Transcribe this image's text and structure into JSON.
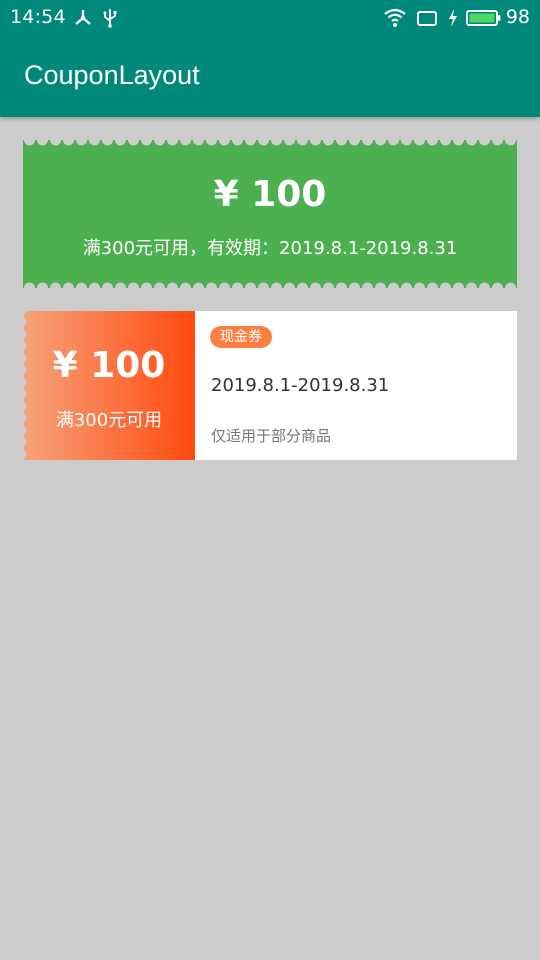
{
  "status_bar": {
    "time": "14:54",
    "battery_percent": "98",
    "icons": [
      "network-share-icon",
      "usb-icon",
      "wifi-icon",
      "screen-icon",
      "charging-icon",
      "battery-icon"
    ]
  },
  "app_bar": {
    "title": "CouponLayout"
  },
  "coupon_green": {
    "amount": "¥ 100",
    "description": "满300元可用，有效期：2019.8.1-2019.8.31",
    "color": "#4caf50"
  },
  "coupon_orange": {
    "amount": "¥ 100",
    "min_spend": "满300元可用",
    "badge": "现金券",
    "date_range": "2019.8.1-2019.8.31",
    "scope": "仅适用于部分商品",
    "gradient_start": "#f6a27b",
    "gradient_end": "#ff4a0f"
  },
  "colors": {
    "primary": "#00897b",
    "background": "#cccccc",
    "badge": "#ff7f42"
  }
}
